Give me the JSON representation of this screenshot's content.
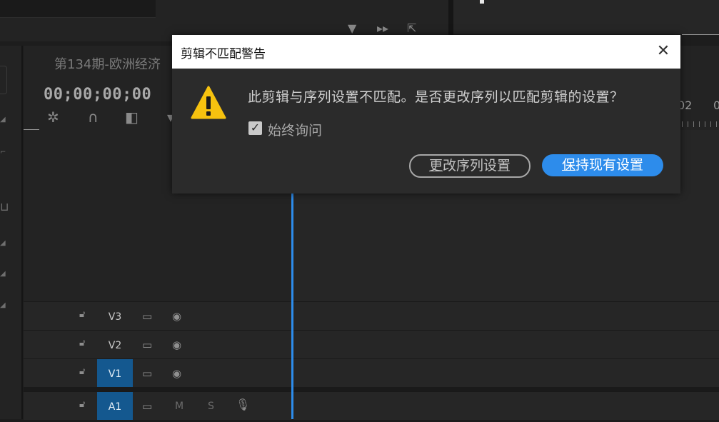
{
  "sequence": {
    "title": "第134期-欧洲经济",
    "timecode": "00;00;00;00",
    "ruler_labels": [
      "02",
      "0"
    ]
  },
  "tracks": [
    {
      "label": "V3",
      "targeted": false,
      "type": "video"
    },
    {
      "label": "V2",
      "targeted": false,
      "type": "video"
    },
    {
      "label": "V1",
      "targeted": true,
      "type": "video"
    },
    {
      "label": "A1",
      "targeted": true,
      "type": "audio",
      "mute": "M",
      "solo": "S"
    }
  ],
  "dialog": {
    "title": "剪辑不匹配警告",
    "message": "此剪辑与序列设置不匹配。是否更改序列以匹配剪辑的设置？",
    "checkbox_label": "始终询问",
    "checkbox_checked": true,
    "change_button_mnemonic": "更",
    "change_button_rest": "改序列设置",
    "keep_button_mnemonic": "保",
    "keep_button_rest": "持现有设置",
    "icon": "warning-icon",
    "colors": {
      "primary": "#2d8ceb",
      "warning": "#f6c20f"
    }
  }
}
